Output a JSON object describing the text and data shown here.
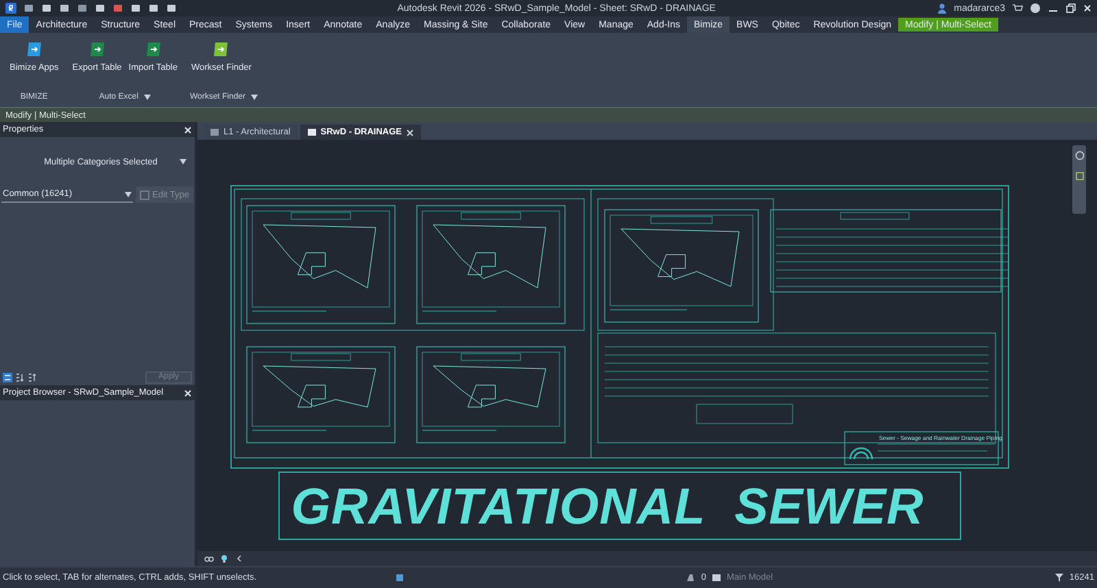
{
  "title_bar": {
    "title": "Autodesk Revit 2026 - SRwD_Sample_Model - Sheet: SRwD - DRAINAGE",
    "user": "madararce3"
  },
  "ribbon_tabs": [
    {
      "label": "File",
      "kind": "file",
      "selected": false
    },
    {
      "label": "Architecture",
      "kind": "tab",
      "selected": false
    },
    {
      "label": "Structure",
      "kind": "tab",
      "selected": false
    },
    {
      "label": "Steel",
      "kind": "tab",
      "selected": false
    },
    {
      "label": "Precast",
      "kind": "tab",
      "selected": false
    },
    {
      "label": "Systems",
      "kind": "tab",
      "selected": false
    },
    {
      "label": "Insert",
      "kind": "tab",
      "selected": false
    },
    {
      "label": "Annotate",
      "kind": "tab",
      "selected": false
    },
    {
      "label": "Analyze",
      "kind": "tab",
      "selected": false
    },
    {
      "label": "Massing & Site",
      "kind": "tab",
      "selected": false
    },
    {
      "label": "Collaborate",
      "kind": "tab",
      "selected": false
    },
    {
      "label": "View",
      "kind": "tab",
      "selected": false
    },
    {
      "label": "Manage",
      "kind": "tab",
      "selected": false
    },
    {
      "label": "Add-Ins",
      "kind": "tab",
      "selected": false
    },
    {
      "label": "Bimize",
      "kind": "tab",
      "selected": true
    },
    {
      "label": "BWS",
      "kind": "tab",
      "selected": false
    },
    {
      "label": "Qbitec",
      "kind": "tab",
      "selected": false
    },
    {
      "label": "Revolution Design",
      "kind": "tab",
      "selected": false
    },
    {
      "label": "Modify | Multi-Select",
      "kind": "context",
      "selected": false
    }
  ],
  "ribbon_panels": [
    {
      "label": "BIMIZE",
      "dropdown": false,
      "buttons": [
        {
          "label": "Bimize Apps",
          "color": "#2a9be0"
        }
      ]
    },
    {
      "label": "Auto Excel",
      "dropdown": true,
      "buttons": [
        {
          "label": "Export Table",
          "color": "#1f8a4c"
        },
        {
          "label": "Import Table",
          "color": "#1f8a4c"
        }
      ]
    },
    {
      "label": "Workset Finder",
      "dropdown": true,
      "buttons": [
        {
          "label": "Workset Finder",
          "color": "#7ec23a"
        }
      ]
    }
  ],
  "options_bar": {
    "label": "Modify | Multi-Select"
  },
  "properties": {
    "title": "Properties",
    "type_selector": "Multiple Categories Selected",
    "filter": "Common (16241)",
    "edit_type": {
      "label": "Edit Type",
      "disabled": true
    },
    "apply": {
      "label": "Apply",
      "disabled": true
    }
  },
  "project_browser": {
    "title": "Project Browser - SRwD_Sample_Model"
  },
  "view_tabs": [
    {
      "label": "L1 - Architectural",
      "selected": false
    },
    {
      "label": "SRwD - DRAINAGE",
      "selected": true
    }
  ],
  "sheet": {
    "banner": "GRAVITATIONAL  SEWER",
    "title_block": "Sewer - Sewage and Rainwater Drainage Piping"
  },
  "status_bar": {
    "message": "Click to select, TAB for alternates, CTRL adds, SHIFT unselects.",
    "selection_count": "0",
    "model": "Main Model",
    "filter_count": "16241"
  }
}
